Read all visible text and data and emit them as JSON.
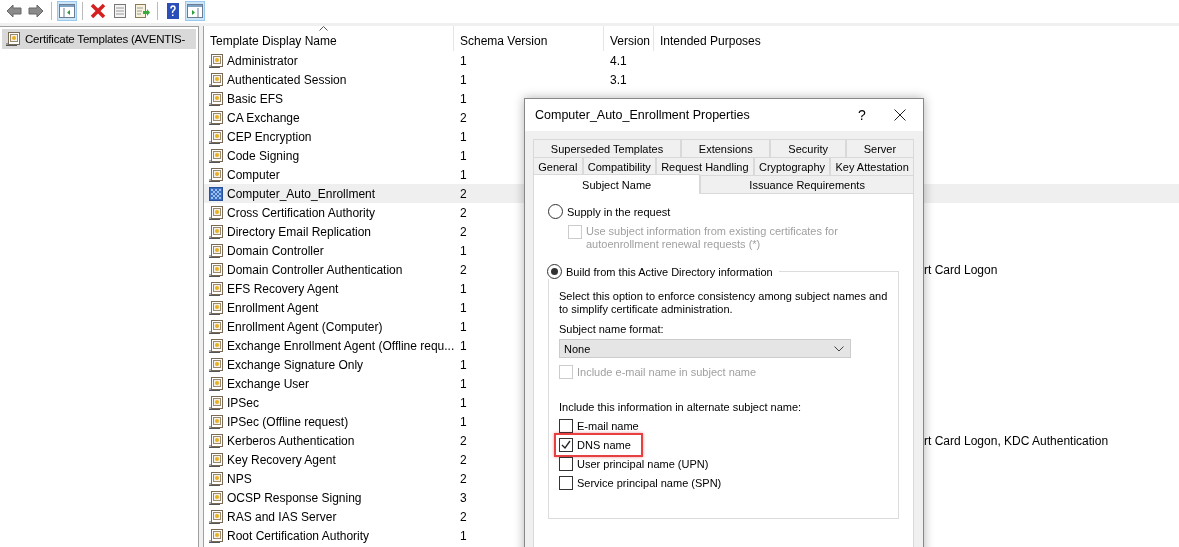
{
  "toolbar": {
    "buttons": [
      {
        "kind": "back",
        "pressed": false
      },
      {
        "kind": "forward",
        "pressed": false
      },
      {
        "kind": "tree-toggle",
        "pressed": true
      },
      {
        "kind": "delete",
        "pressed": false
      },
      {
        "kind": "properties",
        "pressed": false
      },
      {
        "kind": "export",
        "pressed": false
      },
      {
        "kind": "help",
        "pressed": false
      },
      {
        "kind": "action-pane",
        "pressed": true
      }
    ]
  },
  "tree": {
    "items": [
      {
        "label": "Certificate Templates (AVENTIS-",
        "selected": true
      }
    ]
  },
  "list": {
    "columns": [
      {
        "label": "Template Display Name",
        "sorted": true
      },
      {
        "label": "Schema Version",
        "sorted": false
      },
      {
        "label": "Version",
        "sorted": false
      },
      {
        "label": "Intended Purposes",
        "sorted": false
      }
    ],
    "rows": [
      {
        "name": "Administrator",
        "schema": "1",
        "version": "4.1",
        "selected": false
      },
      {
        "name": "Authenticated Session",
        "schema": "1",
        "version": "3.1",
        "selected": false
      },
      {
        "name": "Basic EFS",
        "schema": "1",
        "selected": false
      },
      {
        "name": "CA Exchange",
        "schema": "2",
        "selected": false
      },
      {
        "name": "CEP Encryption",
        "schema": "1",
        "selected": false
      },
      {
        "name": "Code Signing",
        "schema": "1",
        "selected": false
      },
      {
        "name": "Computer",
        "schema": "1",
        "selected": false
      },
      {
        "name": "Computer_Auto_Enrollment",
        "schema": "2",
        "selected": true
      },
      {
        "name": "Cross Certification Authority",
        "schema": "2",
        "selected": false
      },
      {
        "name": "Directory Email Replication",
        "schema": "2",
        "selected": false
      },
      {
        "name": "Domain Controller",
        "schema": "1",
        "selected": false
      },
      {
        "name": "Domain Controller Authentication",
        "schema": "2",
        "purposes": "rt Card Logon",
        "selected": false
      },
      {
        "name": "EFS Recovery Agent",
        "schema": "1",
        "selected": false
      },
      {
        "name": "Enrollment Agent",
        "schema": "1",
        "selected": false
      },
      {
        "name": "Enrollment Agent (Computer)",
        "schema": "1",
        "selected": false
      },
      {
        "name": "Exchange Enrollment Agent (Offline requ...",
        "schema": "1",
        "selected": false
      },
      {
        "name": "Exchange Signature Only",
        "schema": "1",
        "selected": false
      },
      {
        "name": "Exchange User",
        "schema": "1",
        "selected": false
      },
      {
        "name": "IPSec",
        "schema": "1",
        "selected": false
      },
      {
        "name": "IPSec (Offline request)",
        "schema": "1",
        "selected": false
      },
      {
        "name": "Kerberos Authentication",
        "schema": "2",
        "purposes": "rt Card Logon, KDC Authentication",
        "selected": false
      },
      {
        "name": "Key Recovery Agent",
        "schema": "2",
        "selected": false
      },
      {
        "name": "NPS",
        "schema": "2",
        "selected": false
      },
      {
        "name": "OCSP Response Signing",
        "schema": "3",
        "selected": false
      },
      {
        "name": "RAS and IAS Server",
        "schema": "2",
        "selected": false
      },
      {
        "name": "Root Certification Authority",
        "schema": "1",
        "selected": false
      }
    ]
  },
  "dialog": {
    "title": "Computer_Auto_Enrollment Properties",
    "help_button": "?",
    "tab_rows": [
      [
        {
          "label": "Superseded Templates",
          "selected": false
        },
        {
          "label": "Extensions",
          "selected": false
        },
        {
          "label": "Security",
          "selected": false
        },
        {
          "label": "Server",
          "selected": false
        }
      ],
      [
        {
          "label": "General",
          "selected": false
        },
        {
          "label": "Compatibility",
          "selected": false
        },
        {
          "label": "Request Handling",
          "selected": false
        },
        {
          "label": "Cryptography",
          "selected": false
        },
        {
          "label": "Key Attestation",
          "selected": false
        }
      ],
      [
        {
          "label": "Subject Name",
          "selected": true
        },
        {
          "label": "Issuance Requirements",
          "selected": false
        }
      ]
    ],
    "supply_option": {
      "label": "Supply in the request",
      "selected": false
    },
    "renewal_checkbox": {
      "label": "Use subject information from existing certificates for autoenrollment renewal requests (*)",
      "checked": false,
      "disabled": true
    },
    "build_option": {
      "label": "Build from this Active Directory information",
      "selected": true
    },
    "description": "Select this option to enforce consistency among subject names and to simplify certificate administration.",
    "format_label": "Subject name format:",
    "format_value": "None",
    "email_in_subject": {
      "label": "Include e-mail name in subject name",
      "checked": false,
      "disabled": true
    },
    "alt_label": "Include this information in alternate subject name:",
    "alt_options": [
      {
        "label": "E-mail name",
        "checked": false,
        "highlighted": false
      },
      {
        "label": "DNS name",
        "checked": true,
        "highlighted": true
      },
      {
        "label": "User principal name (UPN)",
        "checked": false,
        "highlighted": false
      },
      {
        "label": "Service principal name (SPN)",
        "checked": false,
        "highlighted": false
      }
    ]
  }
}
